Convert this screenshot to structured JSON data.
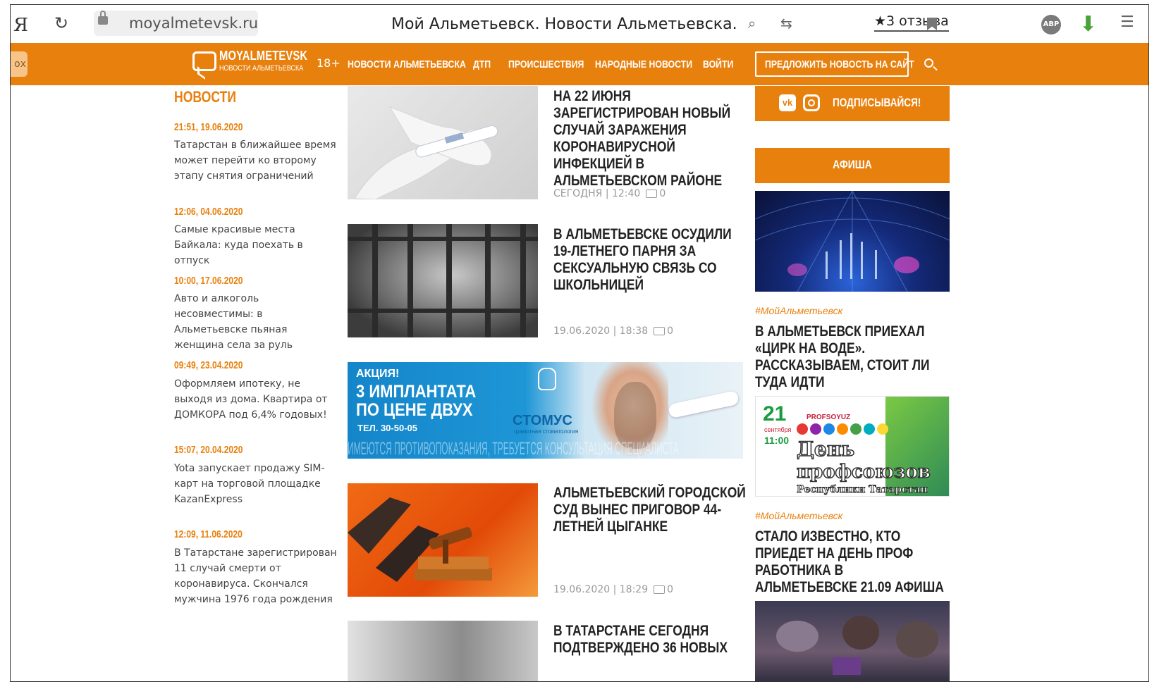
{
  "browser": {
    "url": "moyalmetevsk.ru",
    "title": "Мой Альметьевск. Новости Альметьевска.",
    "reviews": "★3 отзыва",
    "abp": "ABP",
    "yandex": "Я"
  },
  "nav": {
    "pill": "ох",
    "logo_title": "MOYALMETEVSK",
    "logo_sub": "НОВОСТИ АЛЬМЕТЬЕВСКА",
    "age": "18+",
    "links": [
      "НОВОСТИ АЛЬМЕТЬЕВСКА",
      "ДТП",
      "ПРОИСШЕСТВИЯ",
      "НАРОДНЫЕ НОВОСТИ",
      "ВОЙТИ"
    ],
    "suggest": "ПРЕДЛОЖИТЬ НОВОСТЬ НА САЙТ"
  },
  "left": {
    "heading": "НОВОСТИ",
    "items": [
      {
        "time": "21:51, 19.06.2020",
        "text": "Татарстан в ближайшее время может перейти ко второму этапу снятия ограничений"
      },
      {
        "time": "12:06, 04.06.2020",
        "text": "Самые красивые места Байкала: куда поехать в отпуск"
      },
      {
        "time": "10:00, 17.06.2020",
        "text": "Авто и алкоголь несовместимы: в Альметьевске пьяная женщина села за руль"
      },
      {
        "time": "09:49, 23.04.2020",
        "text": "Оформляем ипотеку, не выходя из дома. Квартира от ДОМКОРА под 6,4% годовых!"
      },
      {
        "time": "15:07, 20.04.2020",
        "text": "Yota запускает продажу SIM-карт на торговой площадке KazanExpress"
      },
      {
        "time": "12:09, 11.06.2020",
        "text": "В Татарстане зарегистрирован 11 случай смерти от коронавируса. Скончался мужчина 1976 года рождения"
      }
    ]
  },
  "articles": [
    {
      "title": "НА 22 ИЮНЯ ЗАРЕГИСТРИРОВАН НОВЫЙ СЛУЧАЙ ЗАРАЖЕНИЯ КОРОНАВИРУСНОЙ ИНФЕКЦИЕЙ В АЛЬМЕТЬЕВСКОМ РАЙОНЕ",
      "meta": "СЕГОДНЯ | 12:40",
      "comments": "0"
    },
    {
      "title": "В АЛЬМЕТЬЕВСКЕ ОСУДИЛИ 19-ЛЕТНЕГО ПАРНЯ ЗА СЕКСУАЛЬНУЮ СВЯЗЬ СО ШКОЛЬНИЦЕЙ",
      "meta": "19.06.2020 | 18:38",
      "comments": "0"
    },
    {
      "title": "АЛЬМЕТЬЕВСКИЙ ГОРОДСКОЙ СУД ВЫНЕС ПРИГОВОР 44-ЛЕТНЕЙ ЦЫГАНКЕ",
      "meta": "19.06.2020 | 18:29",
      "comments": "0"
    },
    {
      "title": "В ТАТАРСТАНЕ СЕГОДНЯ ПОДТВЕРЖДЕНО 36 НОВЫХ"
    }
  ],
  "banner": {
    "promo": "АКЦИЯ!",
    "line1": "3 ИМПЛАНТАТА",
    "line2": "ПО ЦЕНЕ ДВУХ",
    "phone": "ТЕЛ. 30-50-05",
    "brand": "СТОМУС",
    "brand_sub": "грамотная стоматология",
    "disclaimer": "ИМЕЮТСЯ ПРОТИВОПОКАЗАНИЯ, ТРЕБУЕТСЯ КОНСУЛЬТАЦИЯ СПЕЦИАЛИСТА"
  },
  "right": {
    "subscribe": "ПОДПИСЫВАЙСЯ!",
    "afisha": "АФИША",
    "items": [
      {
        "tag": "#МойАльметьевск",
        "title": "В АЛЬМЕТЬЕВСК ПРИЕХАЛ «ЦИРК НА ВОДЕ». РАССКАЗЫВАЕМ, СТОИТ ЛИ ТУДА ИДТИ"
      },
      {
        "tag": "#МойАльметьевск",
        "title": "СТАЛО ИЗВЕСТНО, КТО ПРИЕДЕТ НА ДЕНЬ ПРОФ РАБОТНИКА В АЛЬМЕТЬЕВСКЕ 21.09 АФИША"
      }
    ],
    "poster": {
      "day": "21",
      "month": "сентября",
      "time": "11:00",
      "brand": "PROFSOYUZ",
      "line1": "День",
      "line2": "профсоюзов",
      "line3": "Республики Татарстан"
    }
  }
}
